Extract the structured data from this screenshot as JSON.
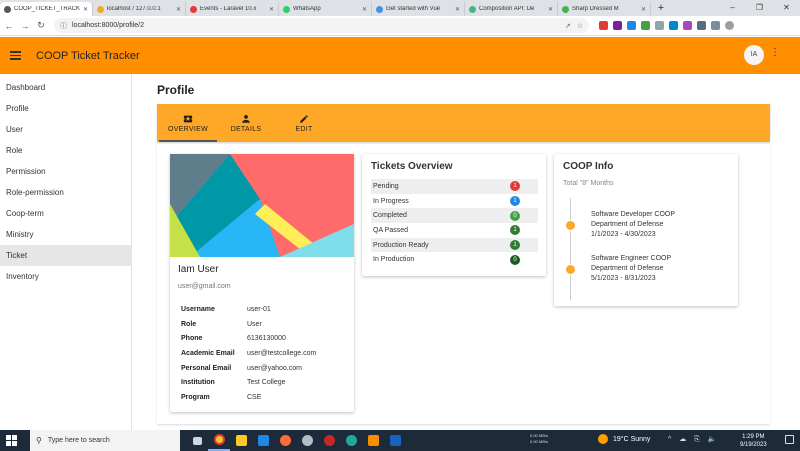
{
  "browser": {
    "tabs": [
      {
        "title": "COOP_TICKET_TRACK",
        "color": "#555555",
        "active": true
      },
      {
        "title": "localhost / 127.0.0.1",
        "color": "#f5a623",
        "active": false
      },
      {
        "title": "Events - Laravel 10.x",
        "color": "#e53935",
        "active": false
      },
      {
        "title": "WhatsApp",
        "color": "#25d366",
        "active": false
      },
      {
        "title": "Get started with Vue",
        "color": "#4a90e2",
        "active": false
      },
      {
        "title": "Composition API: De",
        "color": "#42b883",
        "active": false
      },
      {
        "title": "Sharp Dressed M",
        "color": "#4caf50",
        "active": false
      }
    ],
    "url": "localhost:8000/profile/2"
  },
  "app": {
    "title": "COOP Ticket Tracker",
    "avatar_initials": "IA"
  },
  "sidebar": {
    "items": [
      {
        "label": "Dashboard",
        "key": "dashboard"
      },
      {
        "label": "Profile",
        "key": "profile"
      },
      {
        "label": "User",
        "key": "user"
      },
      {
        "label": "Role",
        "key": "role"
      },
      {
        "label": "Permission",
        "key": "permission"
      },
      {
        "label": "Role-permission",
        "key": "role-permission"
      },
      {
        "label": "Coop-term",
        "key": "coop-term"
      },
      {
        "label": "Ministry",
        "key": "ministry"
      },
      {
        "label": "Ticket",
        "key": "ticket"
      },
      {
        "label": "Inventory",
        "key": "inventory"
      }
    ],
    "active": "ticket"
  },
  "page": {
    "title": "Profile",
    "tabs": [
      {
        "label": "OVERVIEW",
        "icon": "ticket-icon"
      },
      {
        "label": "DETAILS",
        "icon": "person-icon"
      },
      {
        "label": "EDIT",
        "icon": "pencil-icon"
      }
    ]
  },
  "profile": {
    "name": "Iam User",
    "email": "user@gmail.com",
    "fields": [
      {
        "key": "Username",
        "value": "user-01"
      },
      {
        "key": "Role",
        "value": "User"
      },
      {
        "key": "Phone",
        "value": "6136130000"
      },
      {
        "key": "Academic Email",
        "value": "user@testcollege.com"
      },
      {
        "key": "Personal Email",
        "value": "user@yahoo.com"
      },
      {
        "key": "Institution",
        "value": "Test College"
      },
      {
        "key": "Program",
        "value": "CSE"
      }
    ]
  },
  "tickets": {
    "title": "Tickets Overview",
    "rows": [
      {
        "label": "Pending",
        "count": "1",
        "color": "#e53935"
      },
      {
        "label": "In Progress",
        "count": "1",
        "color": "#1e88e5"
      },
      {
        "label": "Completed",
        "count": "0",
        "color": "#43a047"
      },
      {
        "label": "QA Passed",
        "count": "1",
        "color": "#2e7d32"
      },
      {
        "label": "Production Ready",
        "count": "1",
        "color": "#2e7d32"
      },
      {
        "label": "In Production",
        "count": "0",
        "color": "#1b5e20"
      }
    ]
  },
  "coop": {
    "title": "COOP Info",
    "total": "Total \"8\" Months",
    "entries": [
      {
        "role": "Software Developer COOP",
        "org": "Department of Defense",
        "dates": "1/1/2023 - 4/30/2023"
      },
      {
        "role": "Software Engineer COOP",
        "org": "Department of Defense",
        "dates": "5/1/2023 - 8/31/2023"
      }
    ]
  },
  "taskbar": {
    "search_placeholder": "Type here to search",
    "net_up": "0.00 MB/s",
    "net_down": "0.00 MB/s",
    "weather": "19°C  Sunny",
    "time": "1:29 PM",
    "date": "9/19/2023"
  }
}
